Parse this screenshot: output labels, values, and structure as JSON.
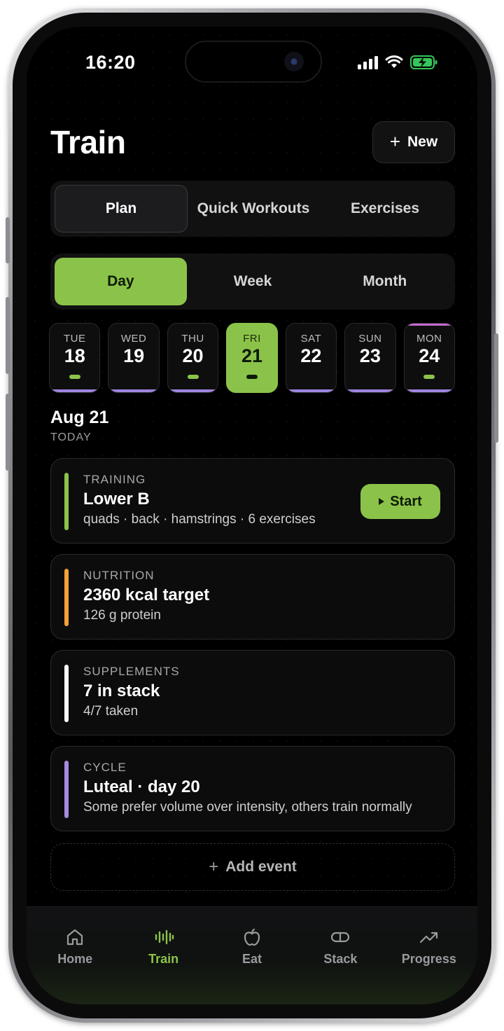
{
  "status_bar": {
    "time": "16:20"
  },
  "header": {
    "title": "Train",
    "new_button_label": "New"
  },
  "primary_tabs": [
    {
      "label": "Plan",
      "active": true
    },
    {
      "label": "Quick Workouts",
      "active": false
    },
    {
      "label": "Exercises",
      "active": false
    }
  ],
  "range_tabs": [
    {
      "label": "Day",
      "active": true
    },
    {
      "label": "Week",
      "active": false
    },
    {
      "label": "Month",
      "active": false
    }
  ],
  "days": [
    {
      "name": "TUE",
      "num": "18",
      "dot": "#8bc34a"
    },
    {
      "name": "WED",
      "num": "19",
      "dot": ""
    },
    {
      "name": "THU",
      "num": "20",
      "dot": "#8bc34a"
    },
    {
      "name": "FRI",
      "num": "21",
      "dot": "#0d1a05",
      "active": true
    },
    {
      "name": "SAT",
      "num": "22",
      "dot": ""
    },
    {
      "name": "SUN",
      "num": "23",
      "dot": ""
    },
    {
      "name": "MON",
      "num": "24",
      "dot": "#8bc34a"
    }
  ],
  "selected_date": {
    "date": "Aug 21",
    "relative": "TODAY"
  },
  "cards": {
    "training": {
      "label": "TRAINING",
      "title": "Lower B",
      "detail": "quads · back · hamstrings · 6 exercises",
      "action": "Start",
      "color": "#8bc34a"
    },
    "nutrition": {
      "label": "NUTRITION",
      "title": "2360 kcal target",
      "detail": "126 g protein",
      "color": "#f5a03a"
    },
    "supplements": {
      "label": "SUPPLEMENTS",
      "title": "7 in stack",
      "detail": "4/7 taken",
      "color": "#ffffff"
    },
    "cycle": {
      "label": "CYCLE",
      "title": "Luteal · day 20",
      "detail": "Some prefer volume over intensity, others train normally",
      "color": "#a78be0"
    }
  },
  "add_event_label": "Add event",
  "tab_bar": [
    {
      "label": "Home",
      "icon": "home-icon",
      "active": false
    },
    {
      "label": "Train",
      "icon": "waveform-icon",
      "active": true
    },
    {
      "label": "Eat",
      "icon": "apple-icon",
      "active": false
    },
    {
      "label": "Stack",
      "icon": "pill-icon",
      "active": false
    },
    {
      "label": "Progress",
      "icon": "trend-up-icon",
      "active": false
    }
  ],
  "colors": {
    "accent": "#8bc34a",
    "background": "#000000",
    "card": "#0c0c0d"
  }
}
